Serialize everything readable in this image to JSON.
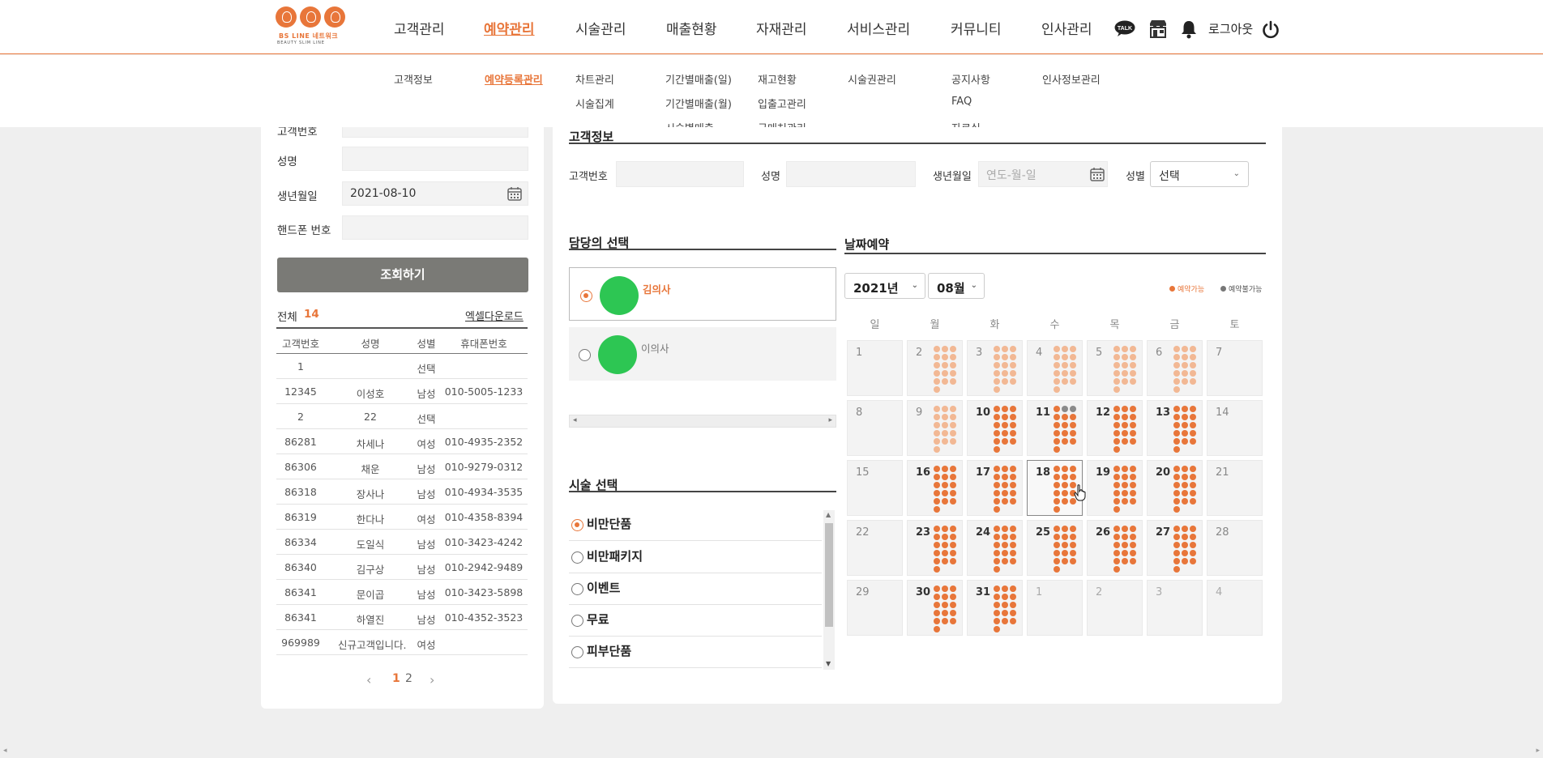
{
  "header": {
    "logo": {
      "title": "BS LINE 네트워크",
      "subtitle": "BEAUTY SLIM LINE"
    },
    "menus": [
      {
        "label": "고객관리",
        "subs": [
          "고객정보"
        ]
      },
      {
        "label": "예약관리",
        "subs": [
          "예약등록관리"
        ]
      },
      {
        "label": "시술관리",
        "subs": [
          "차트관리",
          "시술집계"
        ]
      },
      {
        "label": "매출현황",
        "subs": [
          "기간별매출(일)",
          "기간별매출(월)",
          "시술별매출"
        ]
      },
      {
        "label": "자재관리",
        "subs": [
          "재고현황",
          "입출고관리",
          "구매처관리"
        ]
      },
      {
        "label": "서비스관리",
        "subs": [
          "시술권관리"
        ]
      },
      {
        "label": "커뮤니티",
        "subs": [
          "공지사항",
          "FAQ",
          "자료실"
        ]
      },
      {
        "label": "인사관리",
        "subs": [
          "인사정보관리"
        ]
      }
    ],
    "active_menu": "예약관리",
    "active_sub": "예약등록관리",
    "talk_label": "TALK",
    "logout_label": "로그아웃",
    "accent_color": "#e8763a"
  },
  "search_panel": {
    "partial_label": "고객번호",
    "name_label": "성명",
    "name_value": "",
    "birth_label": "생년월일",
    "birth_value": "2021-08-10",
    "phone_label": "핸드폰 번호",
    "phone_value": "",
    "search_button": "조회하기",
    "total_label": "전체",
    "total_count": "14",
    "excel_label": "엑셀다운로드",
    "columns": [
      "고객번호",
      "성명",
      "성별",
      "휴대폰번호"
    ],
    "rows": [
      [
        "1",
        "",
        "선택",
        ""
      ],
      [
        "12345",
        "이성호",
        "남성",
        "010-5005-1233"
      ],
      [
        "2",
        "22",
        "선택",
        ""
      ],
      [
        "86281",
        "차세나",
        "여성",
        "010-4935-2352"
      ],
      [
        "86306",
        "채운",
        "남성",
        "010-9279-0312"
      ],
      [
        "86318",
        "장사나",
        "남성",
        "010-4934-3535"
      ],
      [
        "86319",
        "한다나",
        "여성",
        "010-4358-8394"
      ],
      [
        "86334",
        "도일식",
        "남성",
        "010-3423-4242"
      ],
      [
        "86340",
        "김구상",
        "남성",
        "010-2942-9489"
      ],
      [
        "86341",
        "문이곱",
        "남성",
        "010-3423-5898"
      ],
      [
        "86341",
        "하열진",
        "남성",
        "010-4352-3523"
      ],
      [
        "969989",
        "신규고객입니다.",
        "여성",
        ""
      ]
    ],
    "pagination": {
      "prev": "‹",
      "pages": [
        "1",
        "2"
      ],
      "current": "1",
      "next": "›"
    }
  },
  "customer_info": {
    "title": "고객정보",
    "number_label": "고객번호",
    "number_value": "",
    "name_label": "성명",
    "name_value": "",
    "birth_label": "생년월일",
    "birth_placeholder": "연도-월-일",
    "gender_label": "성별",
    "gender_value": "선택"
  },
  "staff": {
    "title": "담당의 선택",
    "items": [
      {
        "name": "김의사",
        "selected": true,
        "avatar_color": "#2dc653"
      },
      {
        "name": "이의사",
        "selected": false,
        "avatar_color": "#2dc653"
      }
    ]
  },
  "treatment": {
    "title": "시술 선택",
    "options": [
      {
        "label": "비만단품",
        "selected": true
      },
      {
        "label": "비만패키지",
        "selected": false
      },
      {
        "label": "이벤트",
        "selected": false
      },
      {
        "label": "무료",
        "selected": false
      },
      {
        "label": "피부단품",
        "selected": false
      }
    ]
  },
  "calendar": {
    "title": "날짜예약",
    "year": "2021년",
    "month": "08월",
    "legend_available": "예약가능",
    "legend_unavailable": "예약불가능",
    "weekdays": [
      "일",
      "월",
      "화",
      "수",
      "목",
      "금",
      "토"
    ],
    "selected_day": "18",
    "weeks": [
      [
        "1",
        "2",
        "3",
        "4",
        "5",
        "6",
        "7"
      ],
      [
        "8",
        "9",
        "10",
        "11",
        "12",
        "13",
        "14"
      ],
      [
        "15",
        "16",
        "17",
        "18",
        "19",
        "20",
        "21"
      ],
      [
        "22",
        "23",
        "24",
        "25",
        "26",
        "27",
        "28"
      ],
      [
        "29",
        "30",
        "31",
        "1",
        "2",
        "3",
        "4"
      ]
    ]
  }
}
